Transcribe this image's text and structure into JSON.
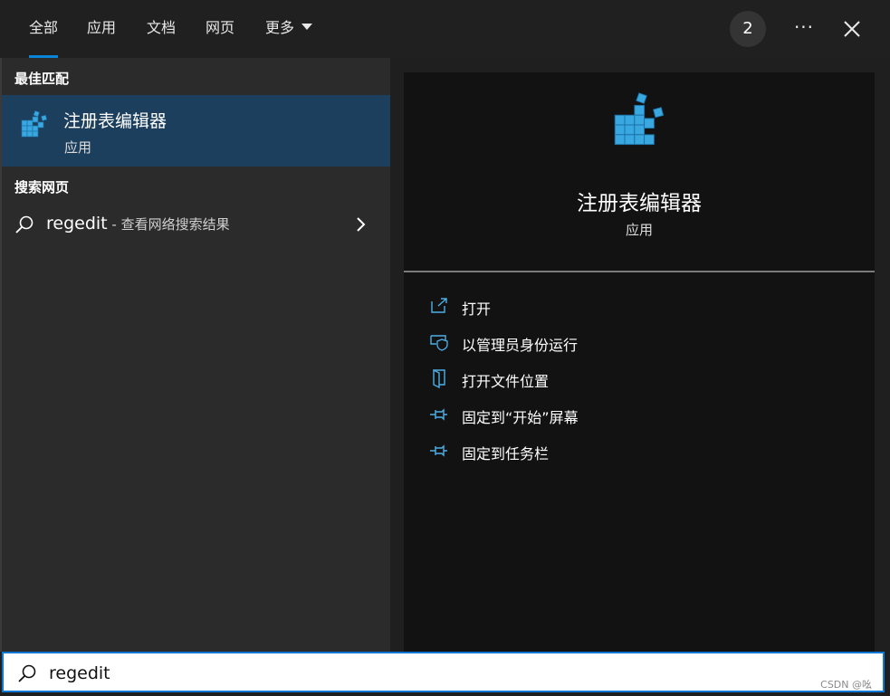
{
  "tabs": [
    {
      "label": "全部",
      "active": true
    },
    {
      "label": "应用"
    },
    {
      "label": "文档"
    },
    {
      "label": "网页"
    },
    {
      "label": "更多"
    }
  ],
  "badge": "2",
  "more_glyph": "···",
  "left": {
    "best_match_heading": "最佳匹配",
    "best_match": {
      "title": "注册表编辑器",
      "subtitle": "应用"
    },
    "web_heading": "搜索网页",
    "web_result": {
      "query": "regedit",
      "separator": " - ",
      "description": "查看网络搜索结果"
    }
  },
  "detail": {
    "title": "注册表编辑器",
    "subtitle": "应用",
    "actions": [
      {
        "label": "打开",
        "icon": "open-icon"
      },
      {
        "label": "以管理员身份运行",
        "icon": "shield-icon"
      },
      {
        "label": "打开文件位置",
        "icon": "folder-icon"
      },
      {
        "label": "固定到“开始”屏幕",
        "icon": "pin-icon"
      },
      {
        "label": "固定到任务栏",
        "icon": "pin-icon"
      }
    ]
  },
  "search": {
    "value": "regedit"
  },
  "watermark": "CSDN @吆",
  "colors": {
    "accent": "#0a84d6",
    "selected": "#1d3f5e",
    "icon_blue": "#39a7e0"
  }
}
